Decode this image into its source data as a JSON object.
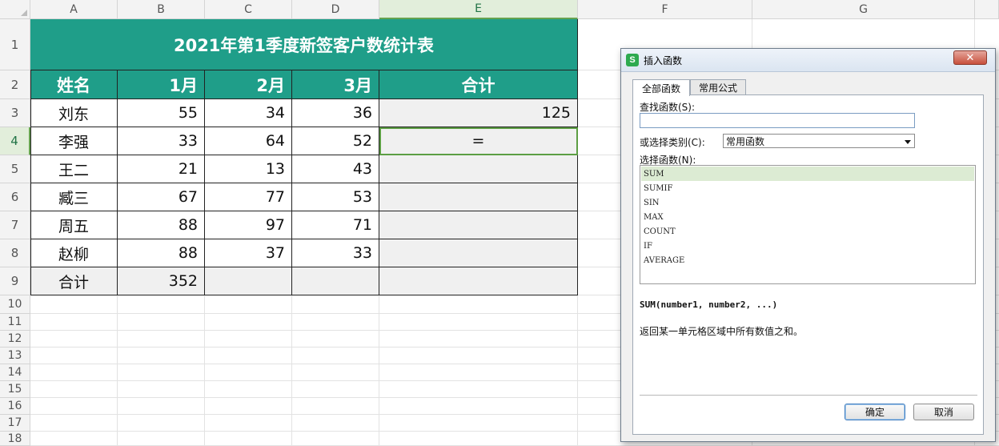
{
  "sheet": {
    "columns": [
      "A",
      "B",
      "C",
      "D",
      "E",
      "F",
      "G"
    ],
    "rows": [
      "1",
      "2",
      "3",
      "4",
      "5",
      "6",
      "7",
      "8",
      "9",
      "10",
      "11",
      "12",
      "13",
      "14",
      "15",
      "16",
      "17",
      "18"
    ],
    "selected_column": "E",
    "selected_row": "4",
    "title": "2021年第1季度新签客户数统计表",
    "headers": [
      "姓名",
      "1月",
      "2月",
      "3月",
      "合计"
    ],
    "data": [
      {
        "name": "刘东",
        "m1": "55",
        "m2": "34",
        "m3": "36",
        "total": "125"
      },
      {
        "name": "李强",
        "m1": "33",
        "m2": "64",
        "m3": "52",
        "total": "="
      },
      {
        "name": "王二",
        "m1": "21",
        "m2": "13",
        "m3": "43",
        "total": ""
      },
      {
        "name": "臧三",
        "m1": "67",
        "m2": "77",
        "m3": "53",
        "total": ""
      },
      {
        "name": "周五",
        "m1": "88",
        "m2": "97",
        "m3": "71",
        "total": ""
      },
      {
        "name": "赵柳",
        "m1": "88",
        "m2": "37",
        "m3": "33",
        "total": ""
      }
    ],
    "summary": {
      "label": "合计",
      "m1": "352",
      "m2": "",
      "m3": "",
      "total": ""
    },
    "colors": {
      "header_bg": "#1f9e89",
      "header_text": "#ffffff",
      "selection": "#5c9e43"
    }
  },
  "dialog": {
    "title": "插入函数",
    "logo": "S",
    "close_label": "✕",
    "tabs": [
      "全部函数",
      "常用公式"
    ],
    "active_tab": "全部函数",
    "search_label": "查找函数(S):",
    "search_value": "",
    "category_label": "或选择类别(C):",
    "category_value": "常用函数",
    "function_label": "选择函数(N):",
    "functions": [
      "SUM",
      "SUMIF",
      "SIN",
      "MAX",
      "COUNT",
      "IF",
      "AVERAGE"
    ],
    "selected_function": "SUM",
    "signature": "SUM(number1, number2, ...)",
    "description": "返回某一单元格区域中所有数值之和。",
    "ok_label": "确定",
    "cancel_label": "取消"
  }
}
